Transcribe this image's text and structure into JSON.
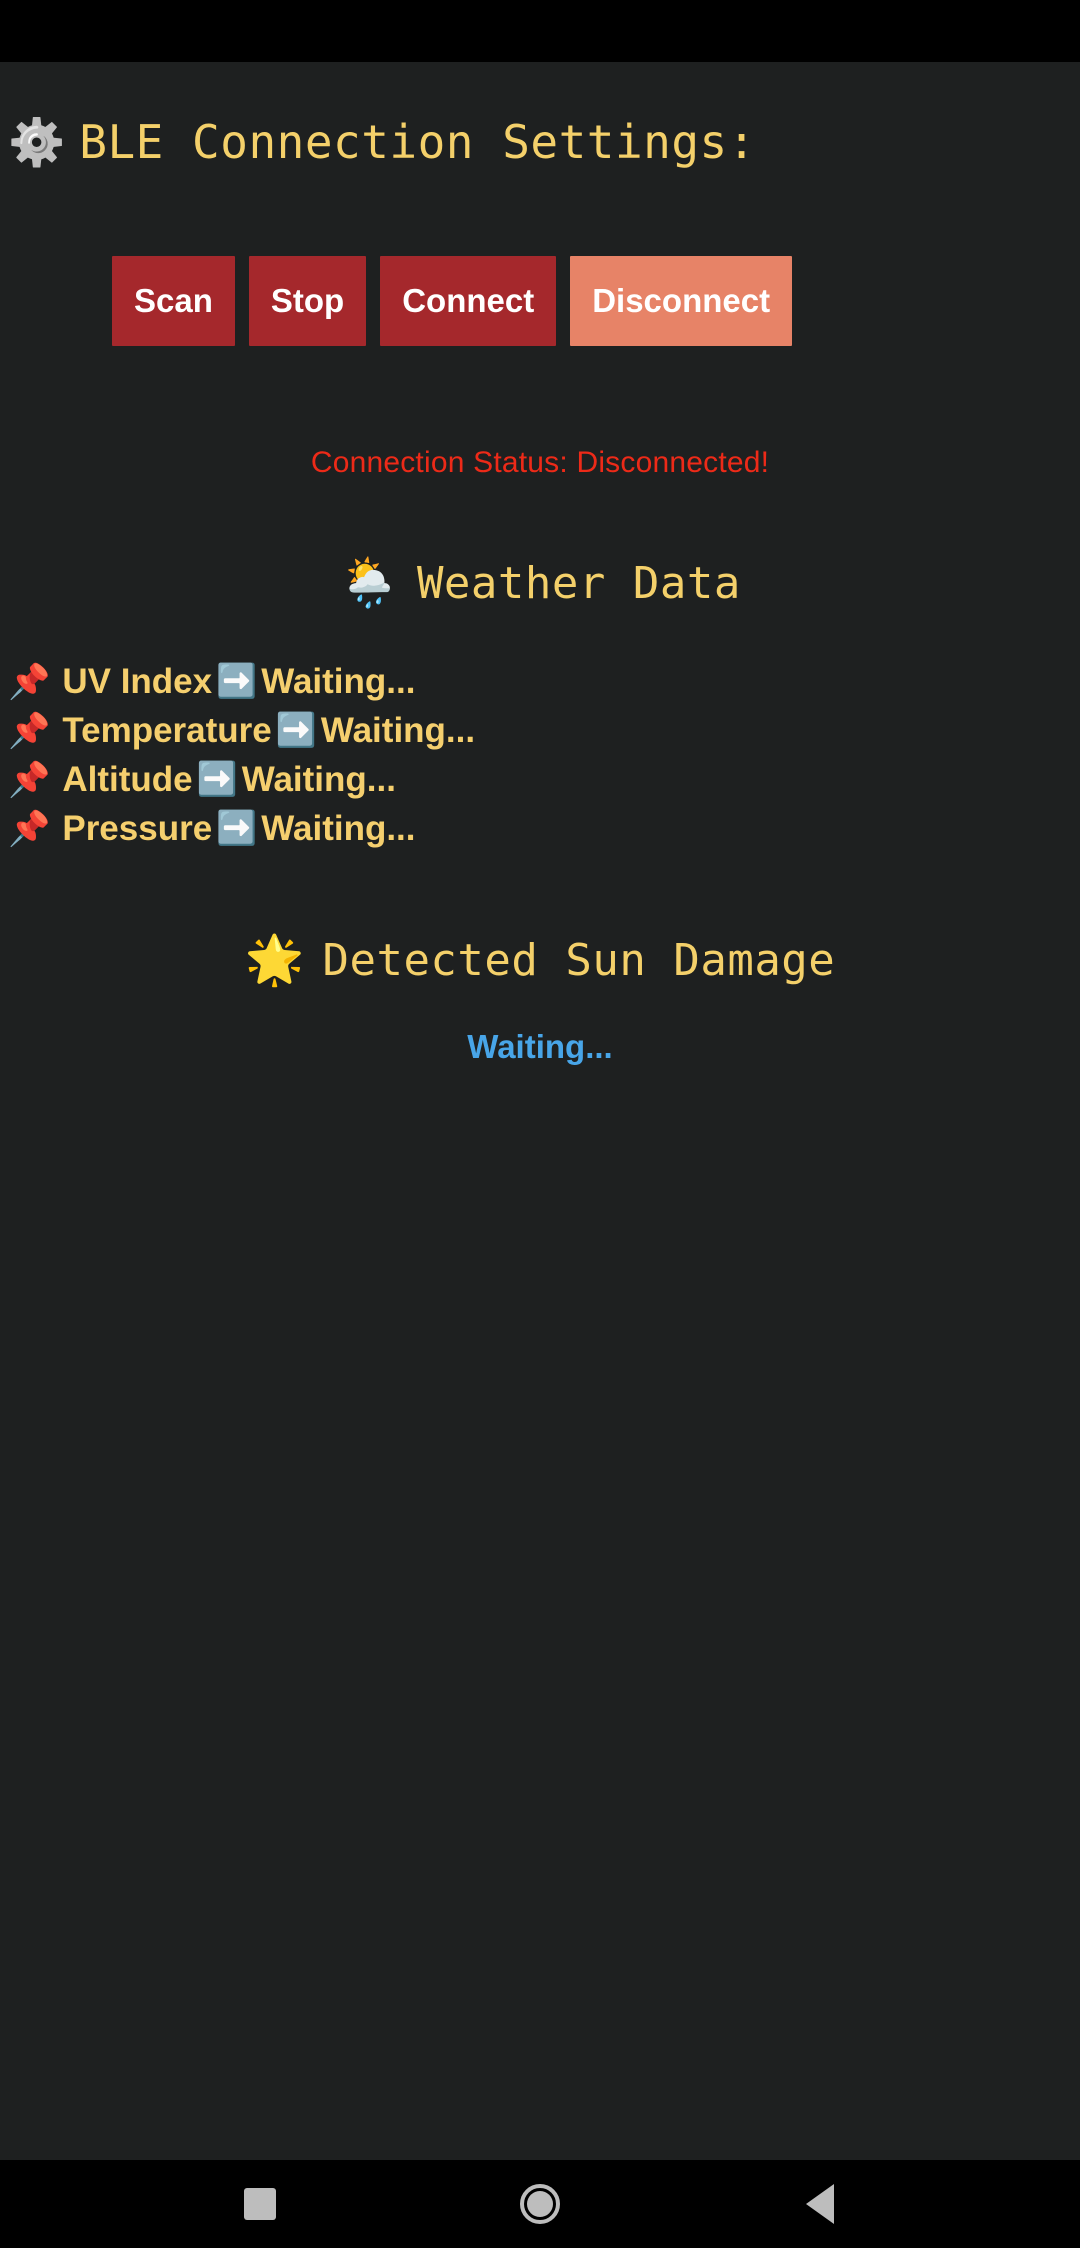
{
  "app": {
    "background_color": "#1e2020",
    "accent_gold": "#f4d06a",
    "status_red": "#ed2a18",
    "button_red": "#a5282c",
    "button_light_red": "#e78367",
    "blue": "#48a5e8"
  },
  "header": {
    "icon": "gear-icon",
    "icon_glyph": "⚙️",
    "title": "BLE Connection Settings:"
  },
  "controls": {
    "buttons": [
      {
        "label": "Scan",
        "name": "scan-button",
        "style": "primary"
      },
      {
        "label": "Stop",
        "name": "stop-button",
        "style": "primary"
      },
      {
        "label": "Connect",
        "name": "connect-button",
        "style": "primary"
      },
      {
        "label": "Disconnect",
        "name": "disconnect-button",
        "style": "light"
      }
    ]
  },
  "connection": {
    "status_text": "Connection Status: Disconnected!"
  },
  "weather": {
    "icon_glyph": "🌦️",
    "icon_name": "sun-behind-rain-cloud-icon",
    "heading": "Weather Data",
    "rows": [
      {
        "pin_glyph": "📌",
        "label": "UV Index",
        "arrow": "➡️",
        "value": "Waiting..."
      },
      {
        "pin_glyph": "📌",
        "label": "Temperature",
        "arrow": "➡️",
        "value": "Waiting..."
      },
      {
        "pin_glyph": "📌",
        "label": "Altitude",
        "arrow": "➡️",
        "value": "Waiting..."
      },
      {
        "pin_glyph": "📌",
        "label": "Pressure ",
        "arrow": "➡️",
        "value": "Waiting..."
      }
    ]
  },
  "sun_damage": {
    "icon_glyph": "🌟",
    "icon_name": "sun-icon",
    "heading": "Detected Sun Damage",
    "value": "Waiting..."
  },
  "navbar": {
    "recents_label": "recents",
    "home_label": "home",
    "back_label": "back"
  }
}
